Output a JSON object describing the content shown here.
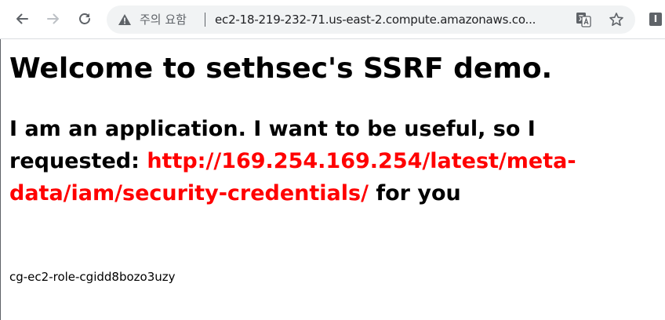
{
  "browser": {
    "security_label": "주의 요함",
    "url": "ec2-18-219-232-71.us-east-2.compute.amazonaws.co...",
    "extension_label": "I"
  },
  "page": {
    "title": "Welcome to sethsec's SSRF demo.",
    "intro": "I am an application. I want to be useful, so I requested:",
    "requested_url": "http://169.254.169.254/latest/meta-data/iam/security-credentials/",
    "suffix": "for you",
    "result": "cg-ec2-role-cgidd8bozo3uzy"
  },
  "colors": {
    "accent_url": "#ff0000",
    "omnibox_bg": "#f1f3f4",
    "icon_gray": "#5f6368"
  }
}
